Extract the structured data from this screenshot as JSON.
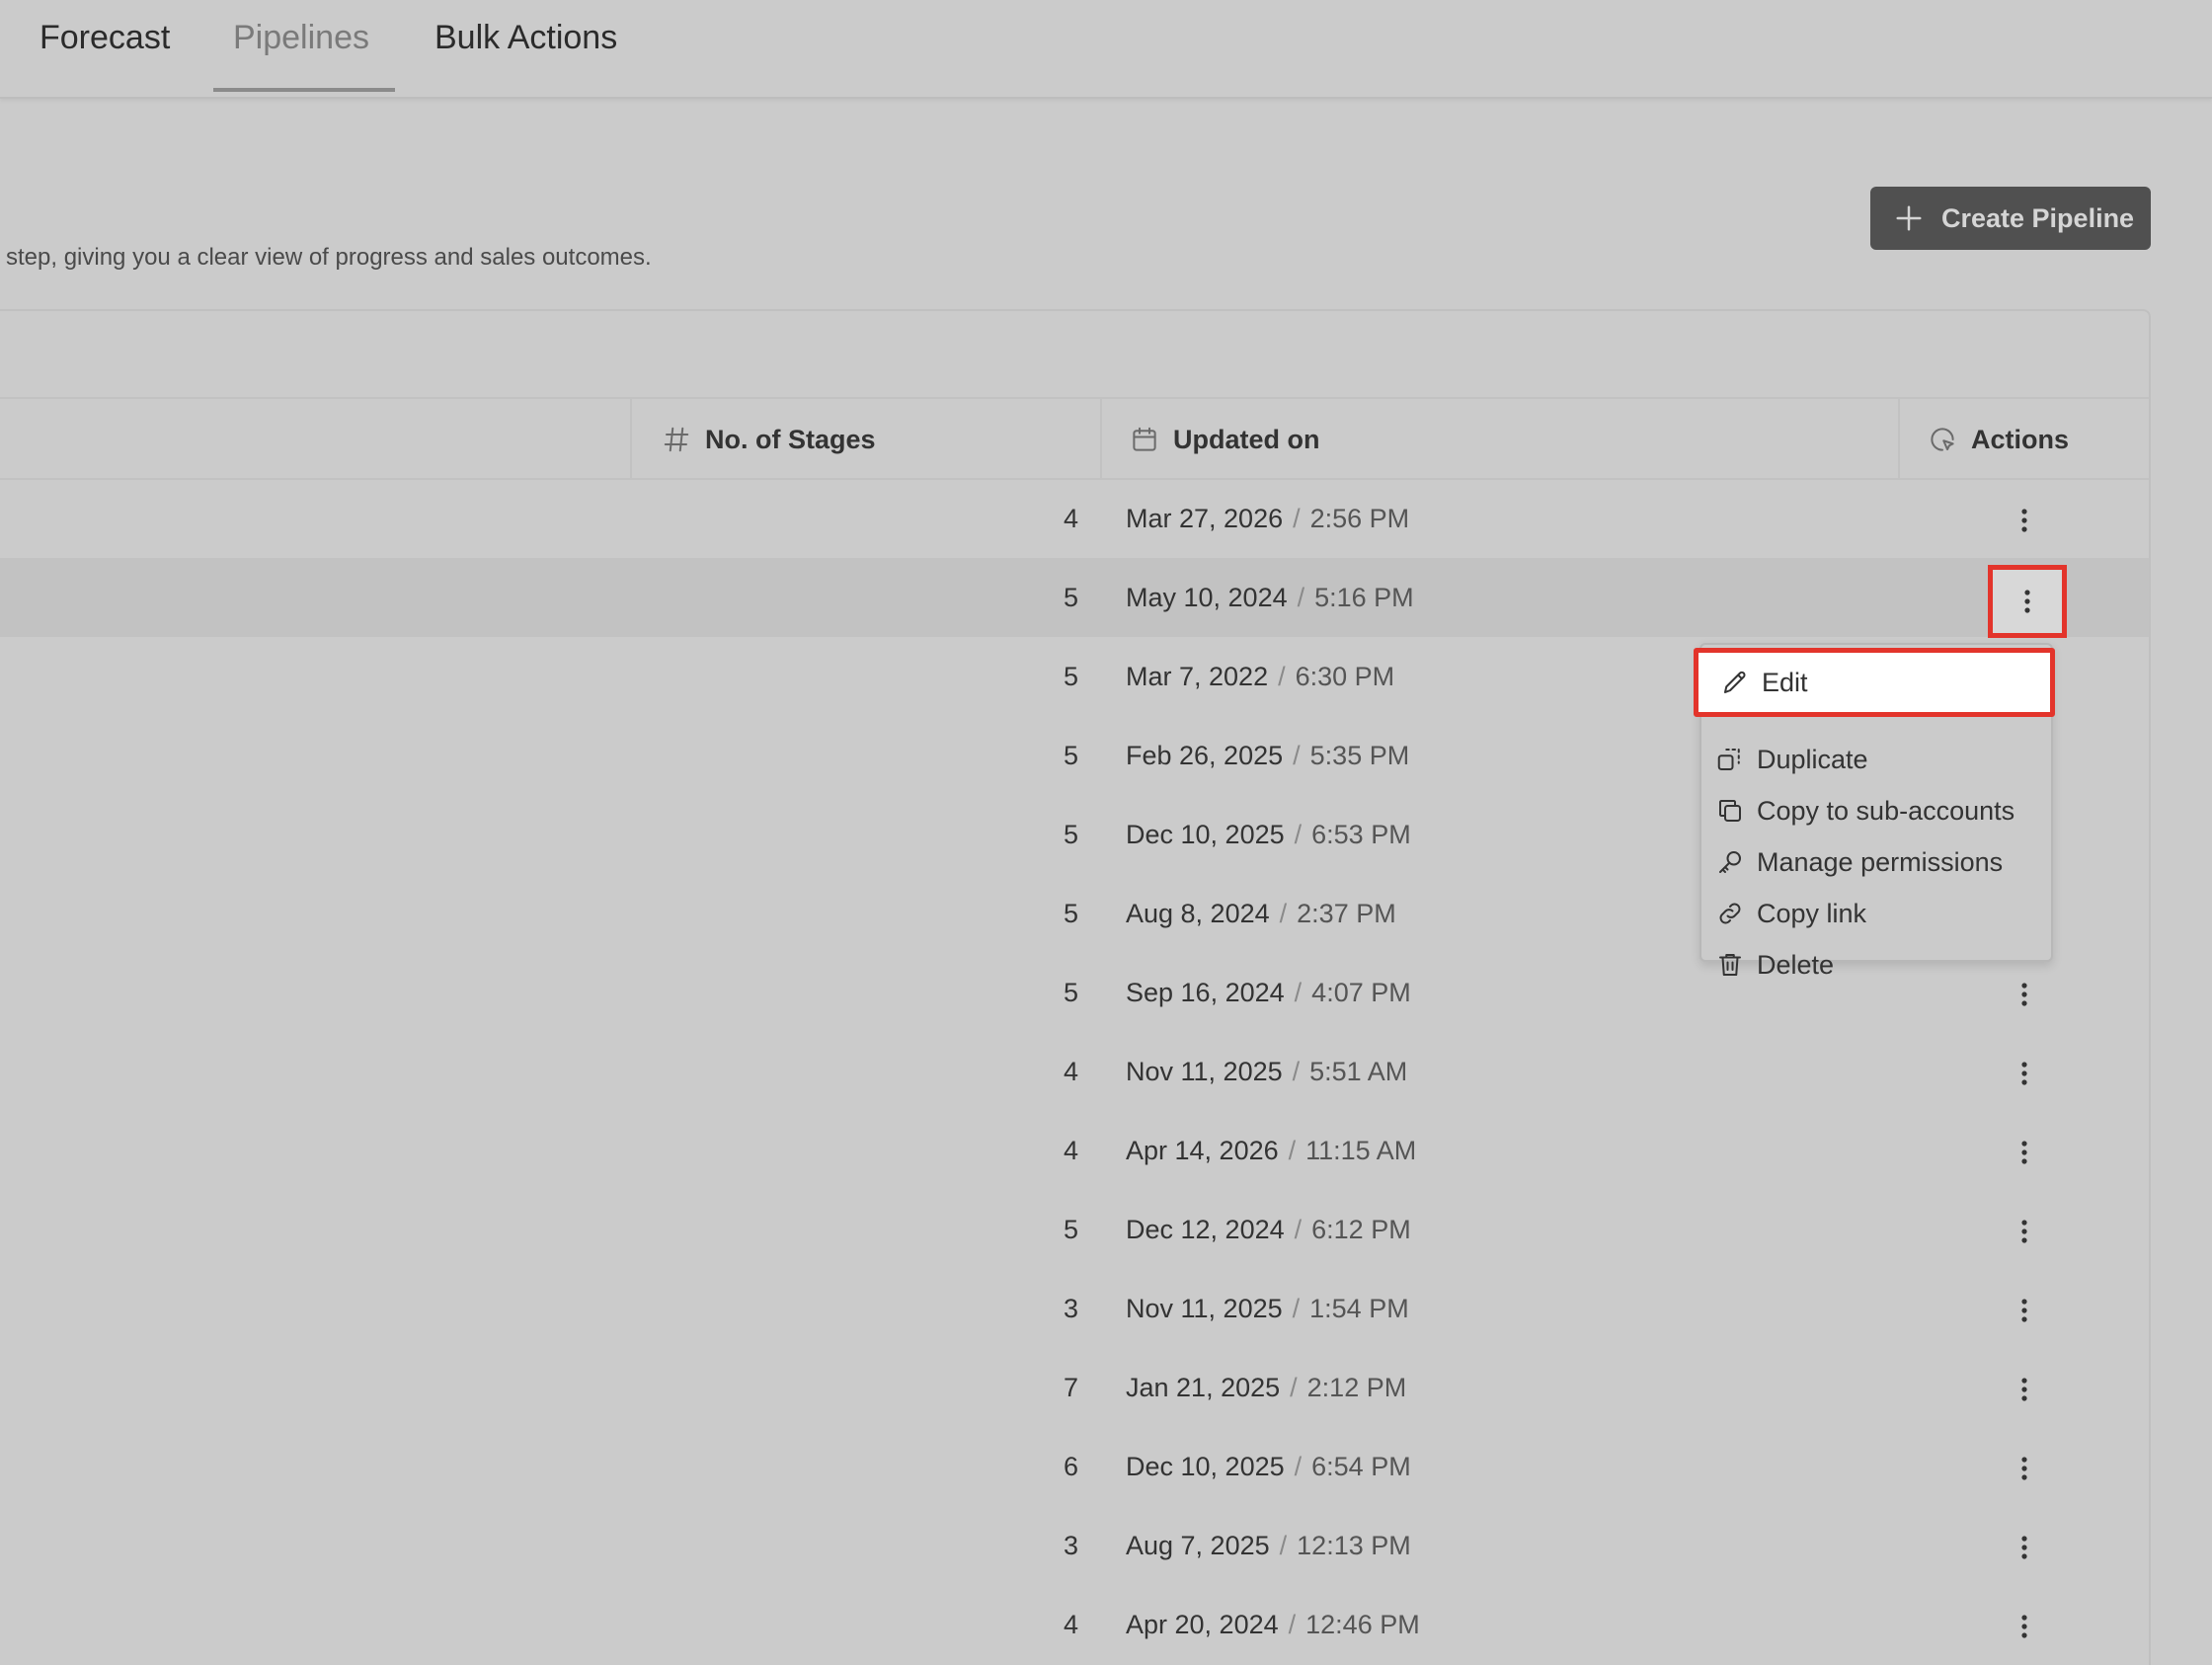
{
  "tabs": [
    {
      "label": "Forecast",
      "active": false
    },
    {
      "label": "Pipelines",
      "active": true
    },
    {
      "label": "Bulk Actions",
      "active": false
    }
  ],
  "header": {
    "subtitle": "step, giving you a clear view of progress and sales outcomes.",
    "create_button_label": "Create Pipeline"
  },
  "table": {
    "columns": {
      "stages": "No. of Stages",
      "updated": "Updated on",
      "actions": "Actions"
    },
    "rows": [
      {
        "stages": "4",
        "date": "Mar 27, 2026",
        "time": "2:56 PM"
      },
      {
        "stages": "5",
        "date": "May 10, 2024",
        "time": "5:16 PM"
      },
      {
        "stages": "5",
        "date": "Mar 7, 2022",
        "time": "6:30 PM"
      },
      {
        "stages": "5",
        "date": "Feb 26, 2025",
        "time": "5:35 PM"
      },
      {
        "stages": "5",
        "date": "Dec 10, 2025",
        "time": "6:53 PM"
      },
      {
        "stages": "5",
        "date": "Aug 8, 2024",
        "time": "2:37 PM"
      },
      {
        "stages": "5",
        "date": "Sep 16, 2024",
        "time": "4:07 PM"
      },
      {
        "stages": "4",
        "date": "Nov 11, 2025",
        "time": "5:51 AM"
      },
      {
        "stages": "4",
        "date": "Apr 14, 2026",
        "time": "11:15 AM"
      },
      {
        "stages": "5",
        "date": "Dec 12, 2024",
        "time": "6:12 PM"
      },
      {
        "stages": "3",
        "date": "Nov 11, 2025",
        "time": "1:54 PM"
      },
      {
        "stages": "7",
        "date": "Jan 21, 2025",
        "time": "2:12 PM"
      },
      {
        "stages": "6",
        "date": "Dec 10, 2025",
        "time": "6:54 PM"
      },
      {
        "stages": "3",
        "date": "Aug 7, 2025",
        "time": "12:13 PM"
      },
      {
        "stages": "4",
        "date": "Apr 20, 2024",
        "time": "12:46 PM"
      }
    ],
    "date_separator": "/"
  },
  "menu": {
    "items": [
      {
        "label": "Edit",
        "icon": "pencil-icon"
      },
      {
        "label": "Duplicate",
        "icon": "duplicate-icon"
      },
      {
        "label": "Copy to sub-accounts",
        "icon": "copy-icon"
      },
      {
        "label": "Manage permissions",
        "icon": "key-icon"
      },
      {
        "label": "Copy link",
        "icon": "link-icon"
      },
      {
        "label": "Delete",
        "icon": "trash-icon"
      }
    ]
  },
  "colors": {
    "highlight": "#e3342b",
    "background": "#cbcbcb",
    "button": "#505050"
  }
}
